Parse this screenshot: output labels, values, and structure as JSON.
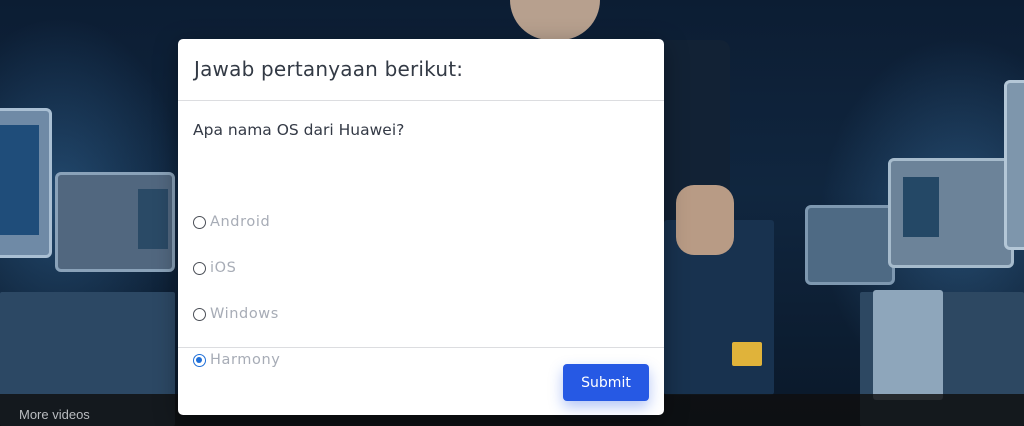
{
  "video": {
    "more_videos_label": "More videos"
  },
  "quiz": {
    "title": "Jawab pertanyaan berikut:",
    "question": "Apa nama OS dari Huawei?",
    "options": [
      {
        "label": "Android",
        "checked": false
      },
      {
        "label": "iOS",
        "checked": false
      },
      {
        "label": "Windows",
        "checked": false
      },
      {
        "label": "Harmony",
        "checked": true
      }
    ],
    "submit_label": "Submit"
  },
  "colors": {
    "accent": "#2659e4",
    "radio_checked": "#1f6fd8",
    "option_text": "#a7acb6"
  }
}
